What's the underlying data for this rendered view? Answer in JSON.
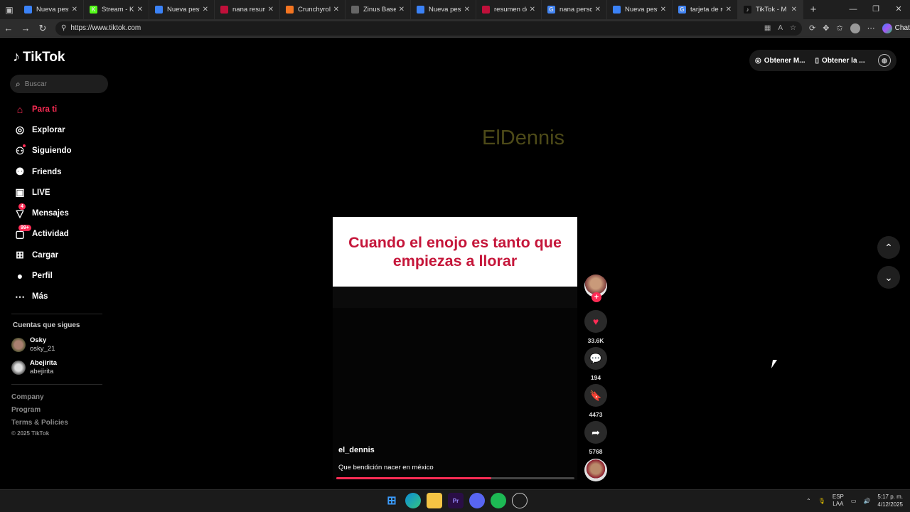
{
  "browser": {
    "tabs": [
      {
        "label": "Nueva pestaña",
        "fav_color": "#3b82f6",
        "fav": ""
      },
      {
        "label": "Stream - Kick D",
        "fav_color": "#53fc18",
        "fav": "K"
      },
      {
        "label": "Nueva pestaña",
        "fav_color": "#3b82f6",
        "fav": ""
      },
      {
        "label": "nana resumen",
        "fav_color": "#c0103a",
        "fav": ""
      },
      {
        "label": "Crunchyroll: Ve",
        "fav_color": "#f47521",
        "fav": ""
      },
      {
        "label": "Zinus Base Indi",
        "fav_color": "#666666",
        "fav": ""
      },
      {
        "label": "Nueva pestaña",
        "fav_color": "#3b82f6",
        "fav": ""
      },
      {
        "label": "resumen del m",
        "fav_color": "#c0103a",
        "fav": ""
      },
      {
        "label": "nana personaje",
        "fav_color": "#4285f4",
        "fav": "G"
      },
      {
        "label": "Nueva pestaña",
        "fav_color": "#3b82f6",
        "fav": ""
      },
      {
        "label": "tarjeta de rega",
        "fav_color": "#4285f4",
        "fav": "G"
      },
      {
        "label": "TikTok - M",
        "fav_color": "#111111",
        "fav": "♪",
        "active": true
      }
    ],
    "url": "https://www.tiktok.com",
    "chat_label": "Chat"
  },
  "tiktok": {
    "logo": "TikTok",
    "search_placeholder": "Buscar",
    "menu": [
      {
        "label": "Para ti",
        "icon": "home-icon"
      },
      {
        "label": "Explorar",
        "icon": "compass-icon"
      },
      {
        "label": "Siguiendo",
        "icon": "following-icon"
      },
      {
        "label": "Friends",
        "icon": "friends-icon"
      },
      {
        "label": "LIVE",
        "icon": "live-icon"
      },
      {
        "label": "Mensajes",
        "icon": "messages-icon",
        "badge": "4"
      },
      {
        "label": "Actividad",
        "icon": "activity-icon",
        "badge": "99+"
      },
      {
        "label": "Cargar",
        "icon": "upload-icon"
      },
      {
        "label": "Perfil",
        "icon": "profile-icon"
      },
      {
        "label": "Más",
        "icon": "more-icon"
      }
    ],
    "following_title": "Cuentas que sigues",
    "following": [
      {
        "name": "Osky",
        "handle": "osky_21"
      },
      {
        "name": "Abejirita",
        "handle": "abejirita"
      }
    ],
    "footer": [
      "Company",
      "Program",
      "Terms & Policies"
    ],
    "copyright": "© 2025 TikTok",
    "top_buttons": [
      "Obtener M...",
      "Obtener la ..."
    ]
  },
  "video": {
    "watermark": "ElDennis",
    "caption_text": "Cuando el enojo es tanto que empiezas a llorar",
    "username": "el_dennis",
    "description": "Que bendición nacer en méxico",
    "progress": 0.65,
    "likes": "33.6K",
    "comments": "194",
    "saves": "4473",
    "shares": "5768"
  },
  "taskbar": {
    "lang_1": "ESP",
    "lang_2": "LAA",
    "time": "5:17 p. m.",
    "date": "4/12/2025"
  }
}
